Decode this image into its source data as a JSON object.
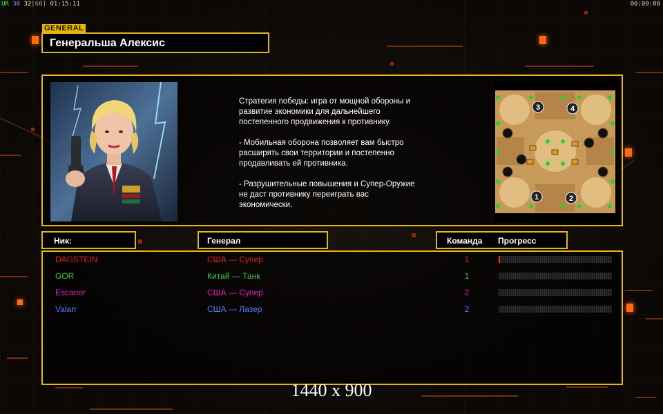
{
  "hud": {
    "left_prefix": "UR",
    "left_n1": "30",
    "left_n2": "32",
    "left_n3": "[60]",
    "left_time": "01:15:11",
    "right_time": "00:00:00"
  },
  "header": {
    "tag": "GENERAL",
    "title": "Генеральша Алексис"
  },
  "description": "Стратегия победы: игра от мощной обороны и\n развитие экономики для дальнейшего\n постепенного продвижения к противнику.\n\n- Мобильная оборона позволяет вам быстро\n расширять свои территории и постепенно\n продавливать ей противника.\n\n- Разрушительные повышения и Супер-Оружие\n не даст противнику переиграть вас\n экономически.",
  "map": {
    "start_positions": [
      "1",
      "2",
      "3",
      "4"
    ]
  },
  "columns": {
    "nick": "Ник:",
    "general": "Генерал",
    "team": "Команда",
    "progress": "Прогресс"
  },
  "players": [
    {
      "nick": "DAGSTEIN",
      "general": "США — Супер",
      "team": "1",
      "color": "#e02020",
      "progress": 0.01
    },
    {
      "nick": "GOR",
      "general": "Китай — Танк",
      "team": "1",
      "color": "#3cc83c",
      "progress": 0
    },
    {
      "nick": "Escanor",
      "general": "США — Супер",
      "team": "2",
      "color": "#e020c0",
      "progress": 0
    },
    {
      "nick": "Valarr",
      "general": "США — Лазер",
      "team": "2",
      "color": "#5078ff",
      "progress": 0
    }
  ],
  "resolution": "1440 x 900",
  "colors": {
    "accent": "#e3b61b",
    "decor": "#ff6a10"
  }
}
